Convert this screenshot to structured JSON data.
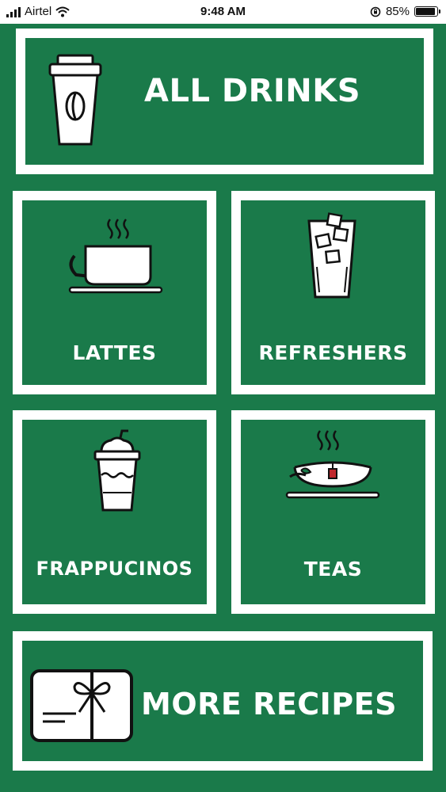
{
  "status_bar": {
    "carrier": "Airtel",
    "time": "9:48 AM",
    "battery_percent": "85%",
    "battery_level": 0.85
  },
  "tiles": {
    "all_drinks": {
      "label": "ALL DRINKS",
      "icon": "coffee-cup-icon"
    },
    "lattes": {
      "label": "LATTES",
      "icon": "latte-cup-icon"
    },
    "refreshers": {
      "label": "REFRESHERS",
      "icon": "iced-glass-icon"
    },
    "frappucinos": {
      "label": "FRAPPUCINOS",
      "icon": "frappuccino-icon"
    },
    "teas": {
      "label": "TEAS",
      "icon": "tea-cup-icon"
    },
    "more_recipes": {
      "label": "MORE RECIPES",
      "icon": "gift-card-icon"
    }
  },
  "colors": {
    "background": "#1a7a4a",
    "border": "#ffffff",
    "tea_tag": "#c0282d"
  }
}
